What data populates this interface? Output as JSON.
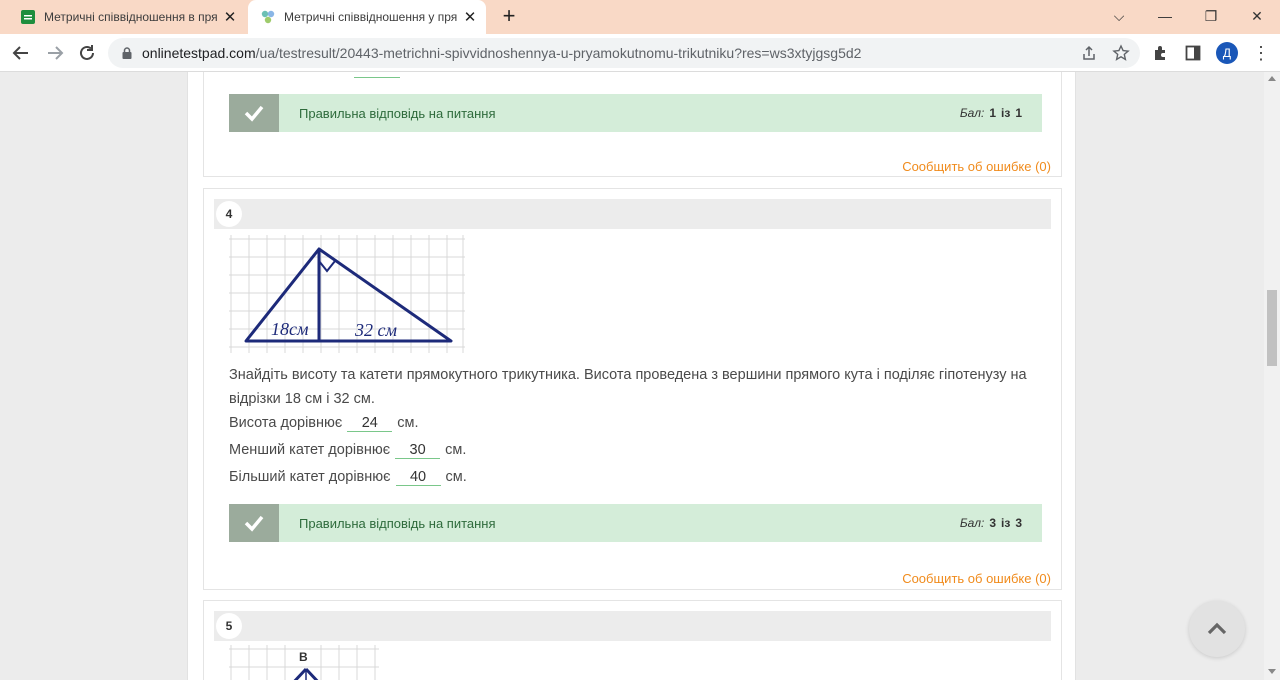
{
  "browser": {
    "tabs": [
      {
        "title": "Метричні співвідношення в пря",
        "close": "✕"
      },
      {
        "title": "Метричні співвідношення у пря",
        "close": "✕"
      }
    ],
    "new_tab": "+",
    "window_controls": [
      "⌵",
      "—",
      "❐",
      "✕"
    ],
    "url_host": "onlinetestpad.com",
    "url_path": "/ua/testresult/20443-metrichni-spivvidnoshennya-u-pryamokutnomu-trikutniku?res=ws3xtyjgsg5d2",
    "profile_initial": "Д",
    "menu": "⋮"
  },
  "prev_question": {
    "result_text": "Правильна відповідь на питання",
    "score": {
      "label": "Бал:",
      "got": "1",
      "of_word": "із",
      "max": "1"
    },
    "report": "Сообщить об ошибке (0)"
  },
  "question4": {
    "number": "4",
    "figure_labels": {
      "left": "18см",
      "right": "32 см"
    },
    "text": "Знайдіть висоту та катети прямокутного трикутника. Висота проведена з вершини прямого кута і поділяє гіпотенузу на відрізки 18 см і 32 см.",
    "answers": [
      {
        "prefix": "Висота дорівнює",
        "value": "24",
        "suffix": "см."
      },
      {
        "prefix": "Менший катет дорівнює",
        "value": "30",
        "suffix": "см."
      },
      {
        "prefix": "Більший катет дорівнює",
        "value": "40",
        "suffix": "см."
      }
    ],
    "result_text": "Правильна відповідь на питання",
    "score": {
      "label": "Бал:",
      "got": "3",
      "of_word": "із",
      "max": "3"
    },
    "report": "Сообщить об ошибке (0)"
  },
  "question5": {
    "number": "5",
    "figure_label": "B"
  },
  "colors": {
    "tabbar": "#f9d9c6",
    "success_bg": "#d4edd9",
    "success_text": "#2e6b3c",
    "report_link": "#f08b1c",
    "figure_lines": "#1d2a7a"
  }
}
